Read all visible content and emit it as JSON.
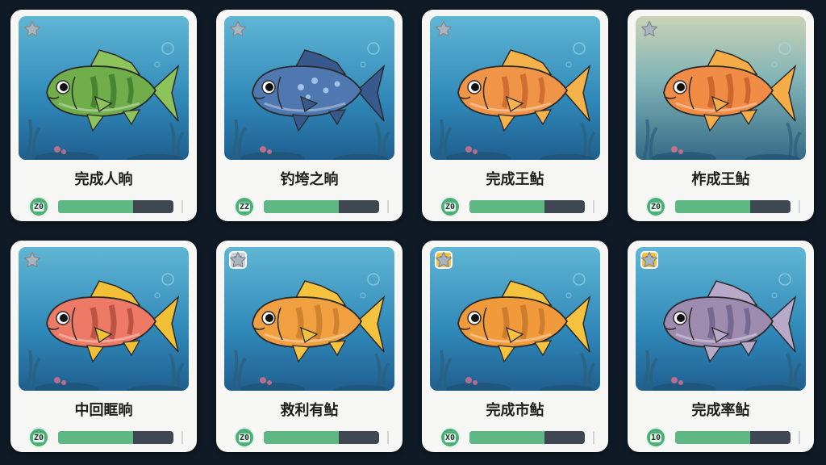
{
  "colors": {
    "background": "#0f1a26",
    "card": "#f6f7f4",
    "bar_fill": "#5fb884",
    "bar_track": "#3f4753",
    "star_on": "#f4c23a",
    "star_off": "#a9b4c0"
  },
  "cards": [
    {
      "name": "完成人晌",
      "level": "Z0",
      "stars": 3,
      "badge": "",
      "progress": 0.65,
      "fish": "green-bass",
      "fish_color": "#6fae4a",
      "fish_stripe": "#3f7a2c",
      "fin_color": "#8cc35a",
      "bg": "deep"
    },
    {
      "name": "钓垮之晌",
      "level": "ZZ",
      "stars": 2,
      "badge": "",
      "progress": 0.65,
      "fish": "blue-grouper",
      "fish_color": "#4f78b0",
      "fish_stripe": "#2d4c82",
      "fin_color": "#38598e",
      "bg": "deep"
    },
    {
      "name": "完成王鲇",
      "level": "Z0",
      "stars": 2,
      "badge": "",
      "progress": 0.65,
      "fish": "orange-perch",
      "fish_color": "#f09448",
      "fish_stripe": "#c8632a",
      "fin_color": "#f5b24a",
      "bg": "deep"
    },
    {
      "name": "柞成王鲇",
      "level": "Z0",
      "stars": 2,
      "badge": "",
      "progress": 0.65,
      "fish": "orange-perch",
      "fish_color": "#f08c46",
      "fish_stripe": "#c75c27",
      "fin_color": "#f6ad48",
      "bg": "murky"
    },
    {
      "name": "中回眶晌",
      "level": "Z0",
      "stars": 3,
      "badge": "",
      "progress": 0.65,
      "fish": "red-snapper",
      "fish_color": "#ec7a66",
      "fish_stripe": "#b24a3a",
      "fin_color": "#f2c037",
      "bg": "deep"
    },
    {
      "name": "救利有鲇",
      "level": "Z0",
      "stars": 1,
      "badge": "silver",
      "progress": 0.65,
      "fish": "yellow-perch",
      "fish_color": "#f0a040",
      "fish_stripe": "#c87a28",
      "fin_color": "#f5c23d",
      "bg": "deep"
    },
    {
      "name": "完成市鲇",
      "level": "X0",
      "stars": 1,
      "badge": "gold",
      "progress": 0.65,
      "fish": "yellow-perch",
      "fish_color": "#f09a3c",
      "fish_stripe": "#c6742a",
      "fin_color": "#f5c23d",
      "bg": "deep"
    },
    {
      "name": "完成率鲇",
      "level": "10",
      "stars": 1,
      "badge": "gold",
      "progress": 0.65,
      "fish": "purple-perch",
      "fish_color": "#9d8cb0",
      "fish_stripe": "#6d5f86",
      "fin_color": "#b9a9c8",
      "bg": "deep"
    }
  ],
  "badge_glyph": "凮"
}
